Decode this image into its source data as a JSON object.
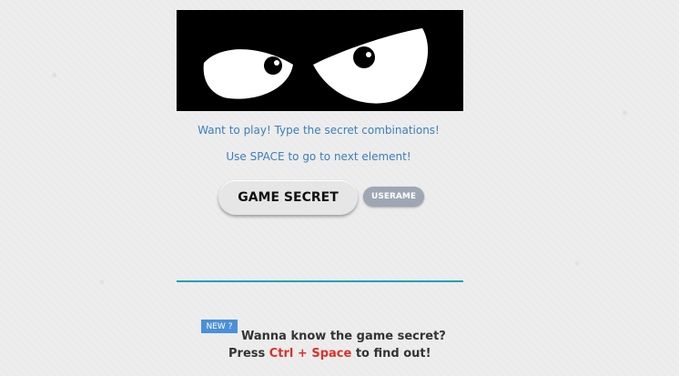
{
  "hero": {
    "image_name": "angry-eyes"
  },
  "instructions": {
    "line1": "Want to play! Type the secret combinations!",
    "line2": "Use SPACE to go to next element!"
  },
  "buttons": {
    "game_secret": "GAME SECRET",
    "username": "USERAME"
  },
  "promo": {
    "badge": "NEW ?",
    "headline": "Wanna know the game secret?",
    "press": "Press",
    "shortcut": "Ctrl + Space",
    "suffix": "to find out!"
  },
  "colors": {
    "accent_text": "#3a7fbd",
    "divider": "#17a2b8",
    "badge_bg": "#4a90d9",
    "shortcut": "#d9322b"
  }
}
